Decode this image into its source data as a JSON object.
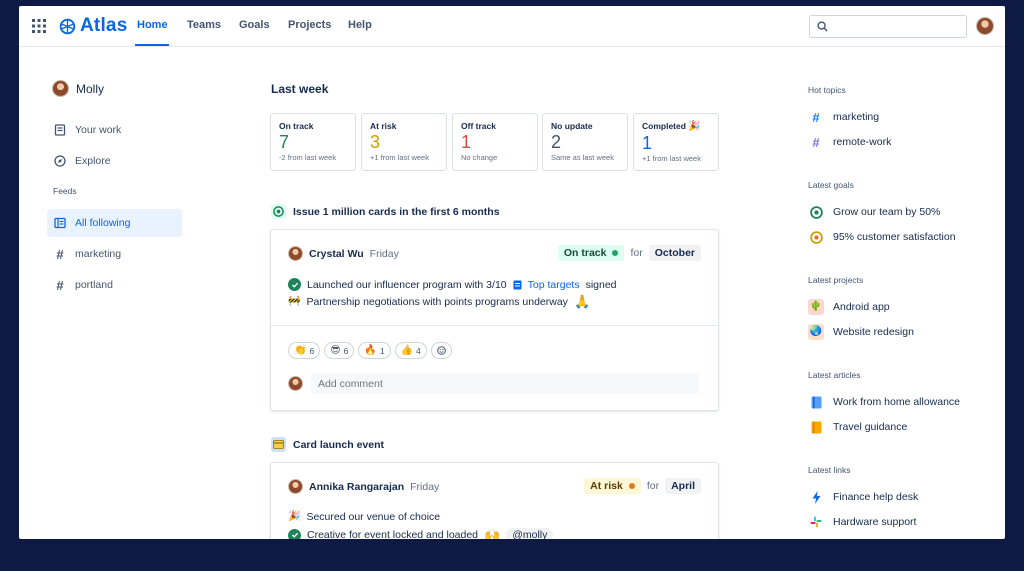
{
  "nav": {
    "logo": "Atlas",
    "links": [
      "Home",
      "Teams",
      "Goals",
      "Projects",
      "Help"
    ],
    "search_placeholder": ""
  },
  "sidebar": {
    "user_name": "Molly",
    "items": [
      "Your work",
      "Explore"
    ],
    "feeds_header": "Feeds",
    "feeds": [
      "All following",
      "marketing",
      "portland"
    ]
  },
  "summary": {
    "title": "Last week",
    "cards": [
      {
        "label": "On track",
        "value": "7",
        "sub": "-2 from last week",
        "color": "#1f845a"
      },
      {
        "label": "At risk",
        "value": "3",
        "sub": "+1 from last week",
        "color": "#cf9f02"
      },
      {
        "label": "Off track",
        "value": "1",
        "sub": "No change",
        "color": "#e2483d"
      },
      {
        "label": "No update",
        "value": "2",
        "sub": "Same as last week",
        "color": "#44546f"
      },
      {
        "label": "Completed",
        "value": "1",
        "sub": "+1 from last week",
        "color": "#0c66e4"
      }
    ]
  },
  "updates": [
    {
      "goal": "Issue 1 million cards in the first 6 months",
      "author": "Crystal Wu",
      "day": "Friday",
      "status": "On track",
      "for": "for",
      "month": "October",
      "line1": "Launched our influencer program with 3/10",
      "line1_link": "Top targets",
      "line1_end": "signed",
      "line2": "Partnership negotiations with points programs underway",
      "reactions": [
        "6",
        "6",
        "1",
        "4"
      ],
      "comment_placeholder": "Add comment"
    },
    {
      "goal": "Card launch event",
      "author": "Annika Rangarajan",
      "day": "Friday",
      "status": "At risk",
      "for": "for",
      "month": "April",
      "line1": "Secured our venue of choice",
      "line2": "Creative for event locked and loaded",
      "mention": "@molly"
    }
  ],
  "right": {
    "hot_topics_header": "Hot topics",
    "hot_topics": [
      "marketing",
      "remote-work"
    ],
    "goals_header": "Latest goals",
    "goals": [
      "Grow our team by 50%",
      "95% customer satisfaction"
    ],
    "projects_header": "Latest projects",
    "projects": [
      "Android app",
      "Website redesign"
    ],
    "articles_header": "Latest articles",
    "articles": [
      "Work from home allowance",
      "Travel guidance"
    ],
    "links_header": "Latest links",
    "links": [
      "Finance help desk",
      "Hardware support"
    ]
  },
  "colors": {
    "accent": "#0c66e4",
    "on_track": "#1f845a",
    "at_risk": "#e2781d",
    "background": "#0f1a44"
  }
}
